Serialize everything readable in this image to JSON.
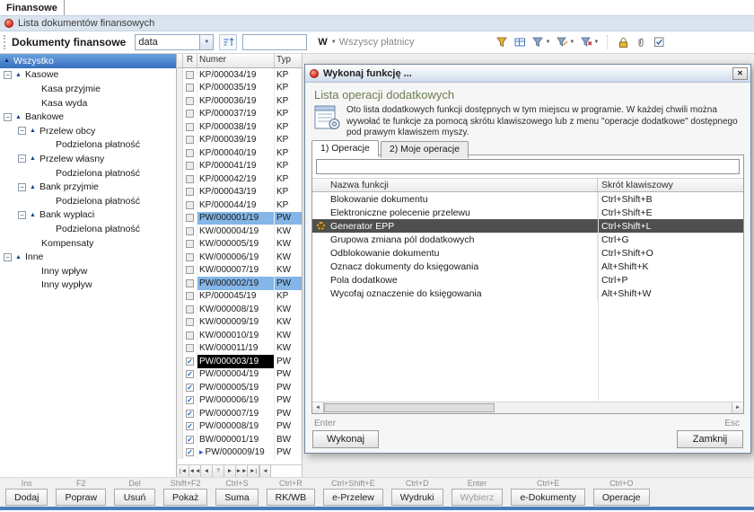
{
  "app": {
    "tab_label": "Finansowe",
    "header_title": "Lista dokumentów finansowych"
  },
  "toolbar": {
    "module_title": "Dokumenty finansowe",
    "date_combo_value": "data",
    "search_value": "",
    "payer_prefix": "W",
    "payer_combo_value": "Wszyscy płatnicy",
    "icons": [
      "sort-ascending-icon",
      "filter-icon",
      "aggregate-icon",
      "filter-list-icon",
      "filter-edit-icon",
      "filter-clear-icon",
      "lock-icon",
      "attachment-icon",
      "select-check-icon"
    ]
  },
  "tree": {
    "items": [
      {
        "label": "Wszystko",
        "indent": 0,
        "tri": true,
        "box": false,
        "selected": true
      },
      {
        "label": "Kasowe",
        "indent": 0,
        "tri": true,
        "box": true,
        "selected": false
      },
      {
        "label": "Kasa przyjmie",
        "indent": 2,
        "tri": false,
        "box": false,
        "selected": false
      },
      {
        "label": "Kasa wyda",
        "indent": 2,
        "tri": false,
        "box": false,
        "selected": false
      },
      {
        "label": "Bankowe",
        "indent": 0,
        "tri": true,
        "box": true,
        "selected": false
      },
      {
        "label": "Przelew obcy",
        "indent": 1,
        "tri": true,
        "box": true,
        "selected": false
      },
      {
        "label": "Podzielona płatność",
        "indent": 3,
        "tri": false,
        "box": false,
        "selected": false
      },
      {
        "label": "Przelew własny",
        "indent": 1,
        "tri": true,
        "box": true,
        "selected": false
      },
      {
        "label": "Podzielona płatność",
        "indent": 3,
        "tri": false,
        "box": false,
        "selected": false
      },
      {
        "label": "Bank przyjmie",
        "indent": 1,
        "tri": true,
        "box": true,
        "selected": false
      },
      {
        "label": "Podzielona płatność",
        "indent": 3,
        "tri": false,
        "box": false,
        "selected": false
      },
      {
        "label": "Bank wypłaci",
        "indent": 1,
        "tri": true,
        "box": true,
        "selected": false
      },
      {
        "label": "Podzielona płatność",
        "indent": 3,
        "tri": false,
        "box": false,
        "selected": false
      },
      {
        "label": "Kompensaty",
        "indent": 2,
        "tri": false,
        "box": false,
        "selected": false
      },
      {
        "label": "Inne",
        "indent": 0,
        "tri": true,
        "box": true,
        "selected": false
      },
      {
        "label": "Inny wpływ",
        "indent": 2,
        "tri": false,
        "box": false,
        "selected": false
      },
      {
        "label": "Inny wypływ",
        "indent": 2,
        "tri": false,
        "box": false,
        "selected": false
      }
    ]
  },
  "grid": {
    "columns": [
      "",
      "R",
      "Numer",
      "Typ"
    ],
    "rows": [
      {
        "numer": "KP/000034/19",
        "typ": "KP",
        "state": "none",
        "checked": false,
        "icon": false
      },
      {
        "numer": "KP/000035/19",
        "typ": "KP",
        "state": "none",
        "checked": false,
        "icon": false
      },
      {
        "numer": "KP/000036/19",
        "typ": "KP",
        "state": "none",
        "checked": false,
        "icon": false
      },
      {
        "numer": "KP/000037/19",
        "typ": "KP",
        "state": "none",
        "checked": false,
        "icon": false
      },
      {
        "numer": "KP/000038/19",
        "typ": "KP",
        "state": "none",
        "checked": false,
        "icon": false
      },
      {
        "numer": "KP/000039/19",
        "typ": "KP",
        "state": "none",
        "checked": false,
        "icon": false
      },
      {
        "numer": "KP/000040/19",
        "typ": "KP",
        "state": "none",
        "checked": false,
        "icon": false
      },
      {
        "numer": "KP/000041/19",
        "typ": "KP",
        "state": "none",
        "checked": false,
        "icon": false
      },
      {
        "numer": "KP/000042/19",
        "typ": "KP",
        "state": "none",
        "checked": false,
        "icon": false
      },
      {
        "numer": "KP/000043/19",
        "typ": "KP",
        "state": "none",
        "checked": false,
        "icon": false
      },
      {
        "numer": "KP/000044/19",
        "typ": "KP",
        "state": "none",
        "checked": false,
        "icon": false
      },
      {
        "numer": "PW/000001/19",
        "typ": "PW",
        "state": "multi",
        "checked": false,
        "icon": false
      },
      {
        "numer": "KW/000004/19",
        "typ": "KW",
        "state": "none",
        "checked": false,
        "icon": false
      },
      {
        "numer": "KW/000005/19",
        "typ": "KW",
        "state": "none",
        "checked": false,
        "icon": false
      },
      {
        "numer": "KW/000006/19",
        "typ": "KW",
        "state": "none",
        "checked": false,
        "icon": false
      },
      {
        "numer": "KW/000007/19",
        "typ": "KW",
        "state": "none",
        "checked": false,
        "icon": false
      },
      {
        "numer": "PW/000002/19",
        "typ": "PW",
        "state": "multi",
        "checked": false,
        "icon": false
      },
      {
        "numer": "KP/000045/19",
        "typ": "KP",
        "state": "none",
        "checked": false,
        "icon": false
      },
      {
        "numer": "KW/000008/19",
        "typ": "KW",
        "state": "none",
        "checked": false,
        "icon": false
      },
      {
        "numer": "KW/000009/19",
        "typ": "KW",
        "state": "none",
        "checked": false,
        "icon": false
      },
      {
        "numer": "KW/000010/19",
        "typ": "KW",
        "state": "none",
        "checked": false,
        "icon": false
      },
      {
        "numer": "KW/000011/19",
        "typ": "KW",
        "state": "none",
        "checked": false,
        "icon": false
      },
      {
        "numer": "PW/000003/19",
        "typ": "PW",
        "state": "focus",
        "checked": true,
        "icon": false
      },
      {
        "numer": "PW/000004/19",
        "typ": "PW",
        "state": "none",
        "checked": true,
        "icon": false
      },
      {
        "numer": "PW/000005/19",
        "typ": "PW",
        "state": "none",
        "checked": true,
        "icon": false
      },
      {
        "numer": "PW/000006/19",
        "typ": "PW",
        "state": "none",
        "checked": true,
        "icon": false
      },
      {
        "numer": "PW/000007/19",
        "typ": "PW",
        "state": "none",
        "checked": true,
        "icon": false
      },
      {
        "numer": "PW/000008/19",
        "typ": "PW",
        "state": "none",
        "checked": true,
        "icon": false
      },
      {
        "numer": "BW/000001/19",
        "typ": "BW",
        "state": "none",
        "checked": true,
        "icon": false
      },
      {
        "numer": "PW/000009/19",
        "typ": "PW",
        "state": "none",
        "checked": true,
        "icon": true
      }
    ],
    "pager": [
      "|◄",
      "◄◄",
      "◄",
      "?",
      "►",
      "►►",
      "►|"
    ]
  },
  "dialog": {
    "title": "Wykonaj funkcję ...",
    "close_glyph": "✕",
    "heading": "Lista operacji dodatkowych",
    "description": "Oto lista dodatkowych funkcji dostępnych w tym miejscu w programie. W każdej chwili można wywołać te funkcje za pomocą skrótu klawiszowego lub z menu \"operacje dodatkowe\" dostępnego pod prawym klawiszem myszy.",
    "tabs": [
      "1) Operacje",
      "2) Moje operacje"
    ],
    "filter_value": "",
    "columns": [
      "Nazwa funkcji",
      "Skrót klawiszowy"
    ],
    "functions": [
      {
        "name": "Blokowanie dokumentu",
        "shortcut": "Ctrl+Shift+B",
        "selected": false
      },
      {
        "name": "Elektroniczne polecenie przelewu",
        "shortcut": "Ctrl+Shift+E",
        "selected": false
      },
      {
        "name": "Generator EPP",
        "shortcut": "Ctrl+Shift+L",
        "selected": true
      },
      {
        "name": "Grupowa zmiana pól dodatkowych",
        "shortcut": "Ctrl+G",
        "selected": false
      },
      {
        "name": "Odblokowanie dokumentu",
        "shortcut": "Ctrl+Shift+O",
        "selected": false
      },
      {
        "name": "Oznacz dokumenty do księgowania",
        "shortcut": "Alt+Shift+K",
        "selected": false
      },
      {
        "name": "Pola dodatkowe",
        "shortcut": "Ctrl+P",
        "selected": false
      },
      {
        "name": "Wycofaj oznaczenie do księgowania",
        "shortcut": "Alt+Shift+W",
        "selected": false
      }
    ],
    "enter_hint": "Enter",
    "esc_hint": "Esc",
    "execute_label": "Wykonaj",
    "close_label": "Zamknij"
  },
  "actions": {
    "buttons": [
      {
        "shortcut": "Ins",
        "label": "Dodaj",
        "disabled": false
      },
      {
        "shortcut": "F2",
        "label": "Popraw",
        "disabled": false
      },
      {
        "shortcut": "Del",
        "label": "Usuń",
        "disabled": false
      },
      {
        "shortcut": "Shift+F2",
        "label": "Pokaż",
        "disabled": false
      },
      {
        "shortcut": "Ctrl+S",
        "label": "Suma",
        "disabled": false
      },
      {
        "shortcut": "Ctrl+R",
        "label": "RK/WB",
        "disabled": false
      },
      {
        "shortcut": "Ctrl+Shift+E",
        "label": "e-Przelew",
        "disabled": false
      },
      {
        "shortcut": "Ctrl+D",
        "label": "Wydruki",
        "disabled": false
      },
      {
        "shortcut": "Enter",
        "label": "Wybierz",
        "disabled": true
      },
      {
        "shortcut": "Ctrl+E",
        "label": "e-Dokumenty",
        "disabled": false
      },
      {
        "shortcut": "Ctrl+O",
        "label": "Operacje",
        "disabled": false
      }
    ]
  },
  "colors": {
    "selection_blue": "#84b6e8",
    "focus_black": "#000000",
    "tree_selected_blue": "#3570bd",
    "heading_olive": "#6b7e4f",
    "bottom_accent_blue": "#4a7ebb"
  }
}
